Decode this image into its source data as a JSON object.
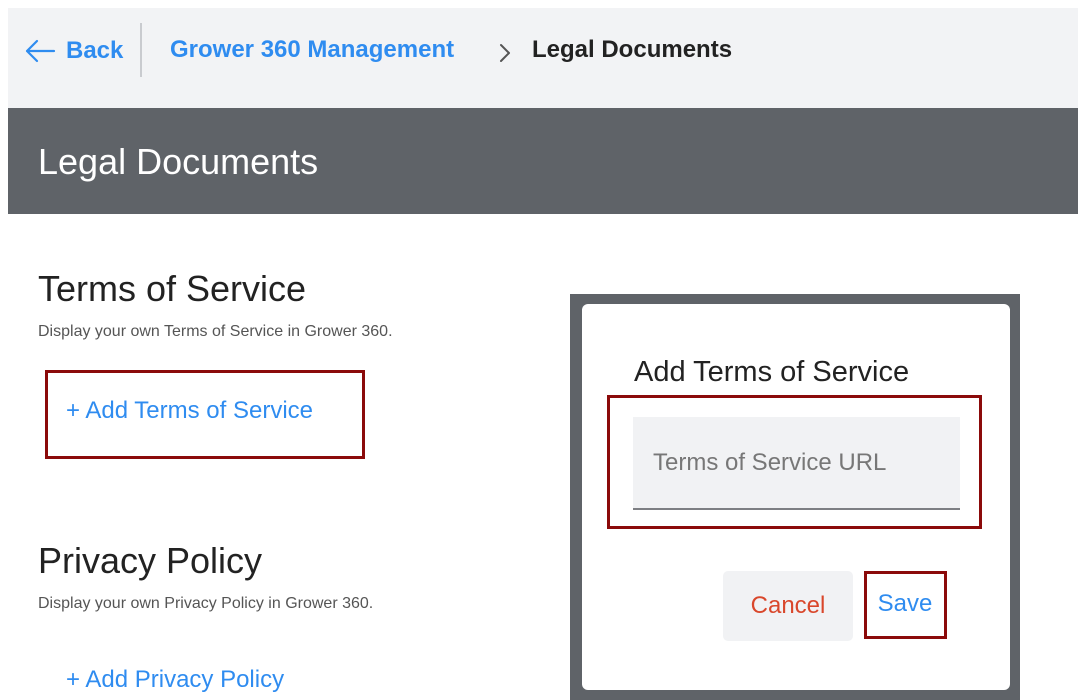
{
  "header": {
    "back_label": "Back",
    "breadcrumb": {
      "parent": "Grower 360 Management",
      "current": "Legal Documents"
    }
  },
  "page": {
    "title": "Legal Documents"
  },
  "sections": {
    "terms": {
      "title": "Terms of Service",
      "description": "Display your own Terms of Service in Grower 360.",
      "add_label": "+ Add Terms of Service"
    },
    "privacy": {
      "title": "Privacy Policy",
      "description": "Display your own Privacy Policy in Grower 360.",
      "add_label": "+ Add Privacy Policy"
    }
  },
  "dialog": {
    "title": "Add Terms of Service",
    "url_input": {
      "value": "",
      "placeholder": "Terms of Service URL"
    },
    "cancel_label": "Cancel",
    "save_label": "Save"
  },
  "icons": {
    "back": "arrow-left-icon",
    "breadcrumb_separator": "chevron-right-icon"
  },
  "colors": {
    "link": "#2f8cf0",
    "cancel": "#d9472b",
    "title_bar": "#5f6368",
    "top_bar": "#f2f3f5",
    "highlight": "#8b0a0a"
  }
}
